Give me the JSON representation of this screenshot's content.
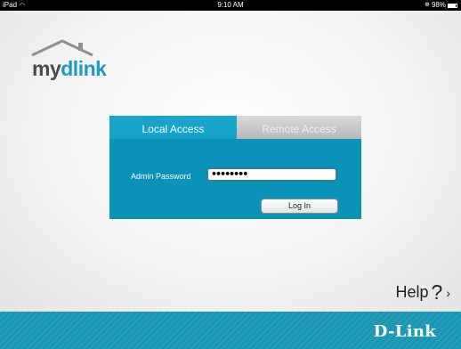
{
  "statusbar": {
    "device": "iPad",
    "time": "9:10 AM",
    "battery": "98%"
  },
  "logo": {
    "part1": "my",
    "part2": "dlink"
  },
  "tabs": {
    "local": "Local Access",
    "remote": "Remote Access"
  },
  "form": {
    "password_label": "Admin Password",
    "password_value": "••••••••",
    "login_label": "Log In"
  },
  "help": {
    "label": "Help",
    "qmark": "?",
    "chevron": "›"
  },
  "footer": {
    "brand": "D-Link"
  },
  "colors": {
    "accent": "#1a9ac6",
    "tab_inactive": "#c8c8c8",
    "footer": "#1996b3"
  },
  "icons": [
    "wifi-icon",
    "lock-icon",
    "battery-icon",
    "house-roof-icon",
    "help-chevron-icon"
  ]
}
